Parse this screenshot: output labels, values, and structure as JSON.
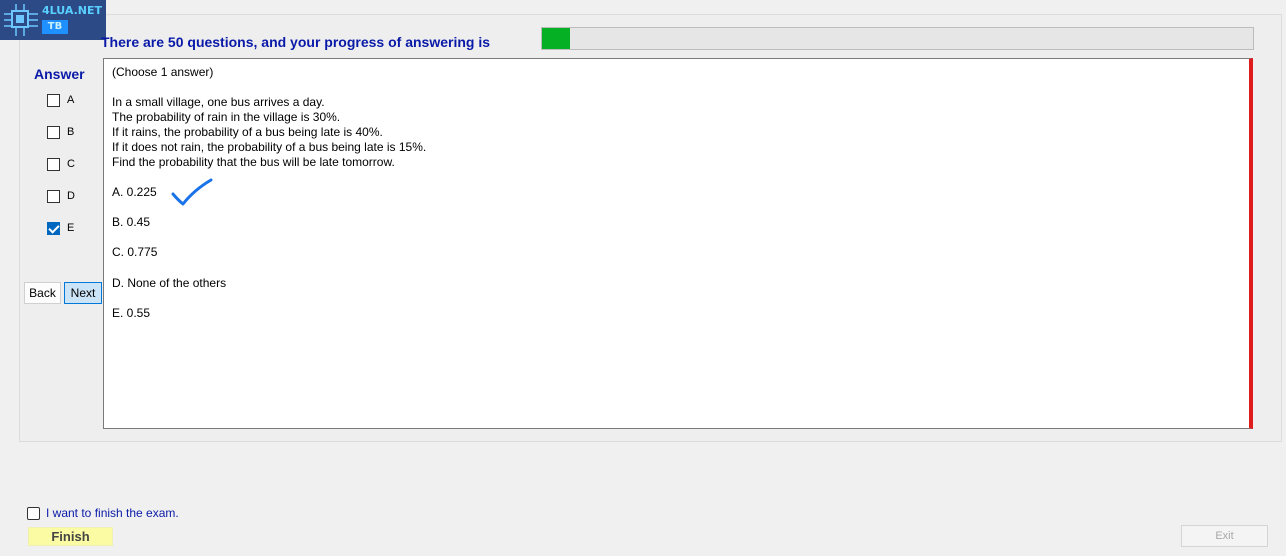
{
  "logo": {
    "text": "4LUA.NET",
    "badge": "TB"
  },
  "header": {
    "progress_text": "There are 50 questions, and your progress of answering is",
    "progress_fraction": 0.04,
    "progress_color": "#06b025"
  },
  "answer_panel": {
    "title": "Answer",
    "options": [
      {
        "label": "A",
        "checked": false
      },
      {
        "label": "B",
        "checked": false
      },
      {
        "label": "C",
        "checked": false
      },
      {
        "label": "D",
        "checked": false
      },
      {
        "label": "E",
        "checked": true
      }
    ],
    "back_label": "Back",
    "next_label": "Next"
  },
  "question": {
    "instruction": "(Choose 1 answer)",
    "stem": [
      "In a small village, one bus arrives a day.",
      "The probability of rain in the village is 30%.",
      "If it rains, the probability of a bus being late is 40%.",
      "If it does not rain, the probability of a bus being late is 15%.",
      "Find the probability that the bus will be late tomorrow."
    ],
    "choices": [
      "A.  0.225",
      "B.  0.45",
      "C.  0.775",
      "D.  None of the others",
      "E.  0.55"
    ]
  },
  "footer": {
    "finish_checkbox_label": "I want to finish the exam.",
    "finish_label": "Finish",
    "exit_label": "Exit"
  },
  "colors": {
    "accent_blue": "#0a1aa8",
    "scroll_red": "#e01b1b"
  }
}
